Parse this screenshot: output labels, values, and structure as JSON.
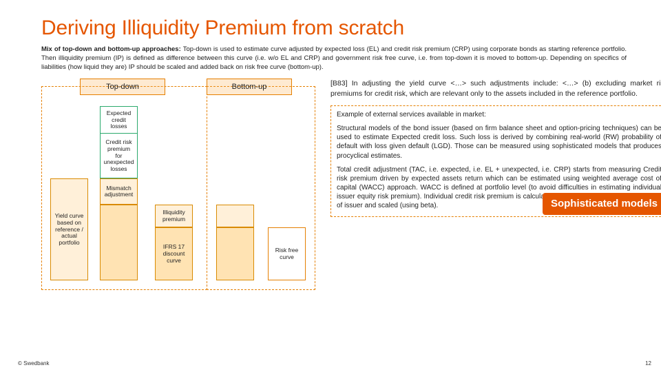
{
  "title": "Deriving Illiquidity Premium from scratch",
  "intro_bold": "Mix of top-down and bottom-up approaches: ",
  "intro_rest": "Top-down is used to estimate curve adjusted by expected loss (EL) and credit risk premium (CRP) using corporate bonds as starting reference portfolio. Then illiquidity premium (IP) is defined as difference between this curve (i.e. w/o EL and CRP) and government risk free curve, i.e. from top-down it is moved to bottom-up. Depending on specifics of liabilities (how liquid they are) IP should be scaled and added back on risk free curve (bottom-up).",
  "headers": {
    "topdown": "Top-down",
    "bottomup": "Bottom-up"
  },
  "bars": {
    "yield": "Yield curve based on reference / actual portfolio",
    "ecl": "Expected credit losses",
    "crp": "Credit risk premium for unexpected losses",
    "mism": "Mismatch adjustment",
    "illiq": "Illiquidity premium",
    "ifrs": "IFRS 17 discount curve",
    "rfc": "Risk free curve"
  },
  "quote": "[B83] In adjusting the yield curve <…>  such adjustments include: <…> (b) excluding market risk premiums for credit risk, which are relevant only to the assets included in the reference portfolio.",
  "callout": {
    "heading": "Example of external services available in market:",
    "p1": "Structural models of the bond issuer (based on firm balance sheet and option-pricing techniques) can be used to estimate Expected credit loss. Such loss is derived by combining real-world (RW) probability of default with loss given default (LGD).  Those can be measured using sophisticated models that produces procyclical estimates.",
    "p2": "Total credit adjustment (TAC, i.e. expected, i.e. EL + unexpected, i.e. CRP) starts from measuring Credit risk premium driven by expected assets return which can be estimated using weighted average cost of capital (WACC)  approach. WACC is defined at portfolio level (to avoid difficulties in estimating individual issuer equity risk premium). Individual credit risk premium is calculated using market implied risk premium of issuer and scaled (using beta).",
    "badge": "Sophisticated models"
  },
  "footer": "© Swedbank",
  "page_number": "12",
  "chart_data": {
    "type": "bar",
    "note": "Stacked waterfall-style decomposition; numeric values are not labeled on slide, heights are illustrative only.",
    "topdown": {
      "yield_curve_reference_portfolio": null,
      "expected_credit_losses": null,
      "credit_risk_premium_unexpected": null,
      "mismatch_adjustment": null,
      "illiquidity_premium": null,
      "ifrs17_discount_curve": null
    },
    "bottomup": {
      "illiquidity_premium": null,
      "risk_free_curve": null
    }
  }
}
